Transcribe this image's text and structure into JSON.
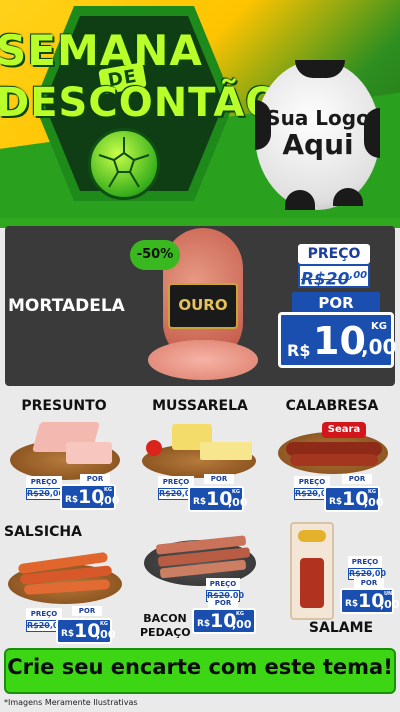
{
  "header": {
    "title_line1": "SEMANA",
    "title_de": "DE",
    "title_line2": "DESCONTÃO",
    "logo_line1": "Sua Logo",
    "logo_line2": "Aqui"
  },
  "featured": {
    "name": "MORTADELA",
    "discount": "-50%",
    "brand_label": "OURO",
    "preco_label": "PREÇO",
    "old_price_int": "R$20",
    "old_price_cents": ",00",
    "por_label": "POR",
    "currency": "R$",
    "price_int": "10",
    "price_cents": ",00",
    "unit": "KG"
  },
  "products": [
    {
      "name": "PRESUNTO",
      "preco_label": "PREÇO",
      "old_int": "R$20",
      "old_cents": ",00",
      "por_label": "POR",
      "currency": "R$",
      "price_int": "10",
      "price_cents": ",00",
      "unit": "KG"
    },
    {
      "name": "MUSSARELA",
      "preco_label": "PREÇO",
      "old_int": "R$20",
      "old_cents": ",00",
      "por_label": "POR",
      "currency": "R$",
      "price_int": "10",
      "price_cents": ",00",
      "unit": "KG"
    },
    {
      "name": "CALABRESA",
      "brand": "Seara",
      "preco_label": "PREÇO",
      "old_int": "R$20",
      "old_cents": ",00",
      "por_label": "POR",
      "currency": "R$",
      "price_int": "10",
      "price_cents": ",00",
      "unit": "KG"
    },
    {
      "name": "SALSICHA",
      "preco_label": "PREÇO",
      "old_int": "R$20",
      "old_cents": ",00",
      "por_label": "POR",
      "currency": "R$",
      "price_int": "10",
      "price_cents": ",00",
      "unit": "KG"
    },
    {
      "name_line1": "BACON",
      "name_line2": "PEDAÇO",
      "preco_label": "PREÇO",
      "old_int": "R$20",
      "old_cents": ",00",
      "por_label": "POR",
      "currency": "R$",
      "price_int": "10",
      "price_cents": ",00",
      "unit": "KG"
    },
    {
      "name": "SALAME",
      "preco_label": "PREÇO",
      "old_int": "R$20",
      "old_cents": ",00",
      "por_label": "POR",
      "currency": "R$",
      "price_int": "10",
      "price_cents": ",00",
      "unit": "UNI"
    }
  ],
  "banner": {
    "text": "Crie seu encarte com este tema!"
  },
  "footnote": "*Imagens Meramente Ilustrativas",
  "colors": {
    "accent_green": "#3dd615",
    "price_blue": "#1a4fb0",
    "header_yellow": "#ffc400",
    "dark_panel": "#3a3a3a"
  }
}
